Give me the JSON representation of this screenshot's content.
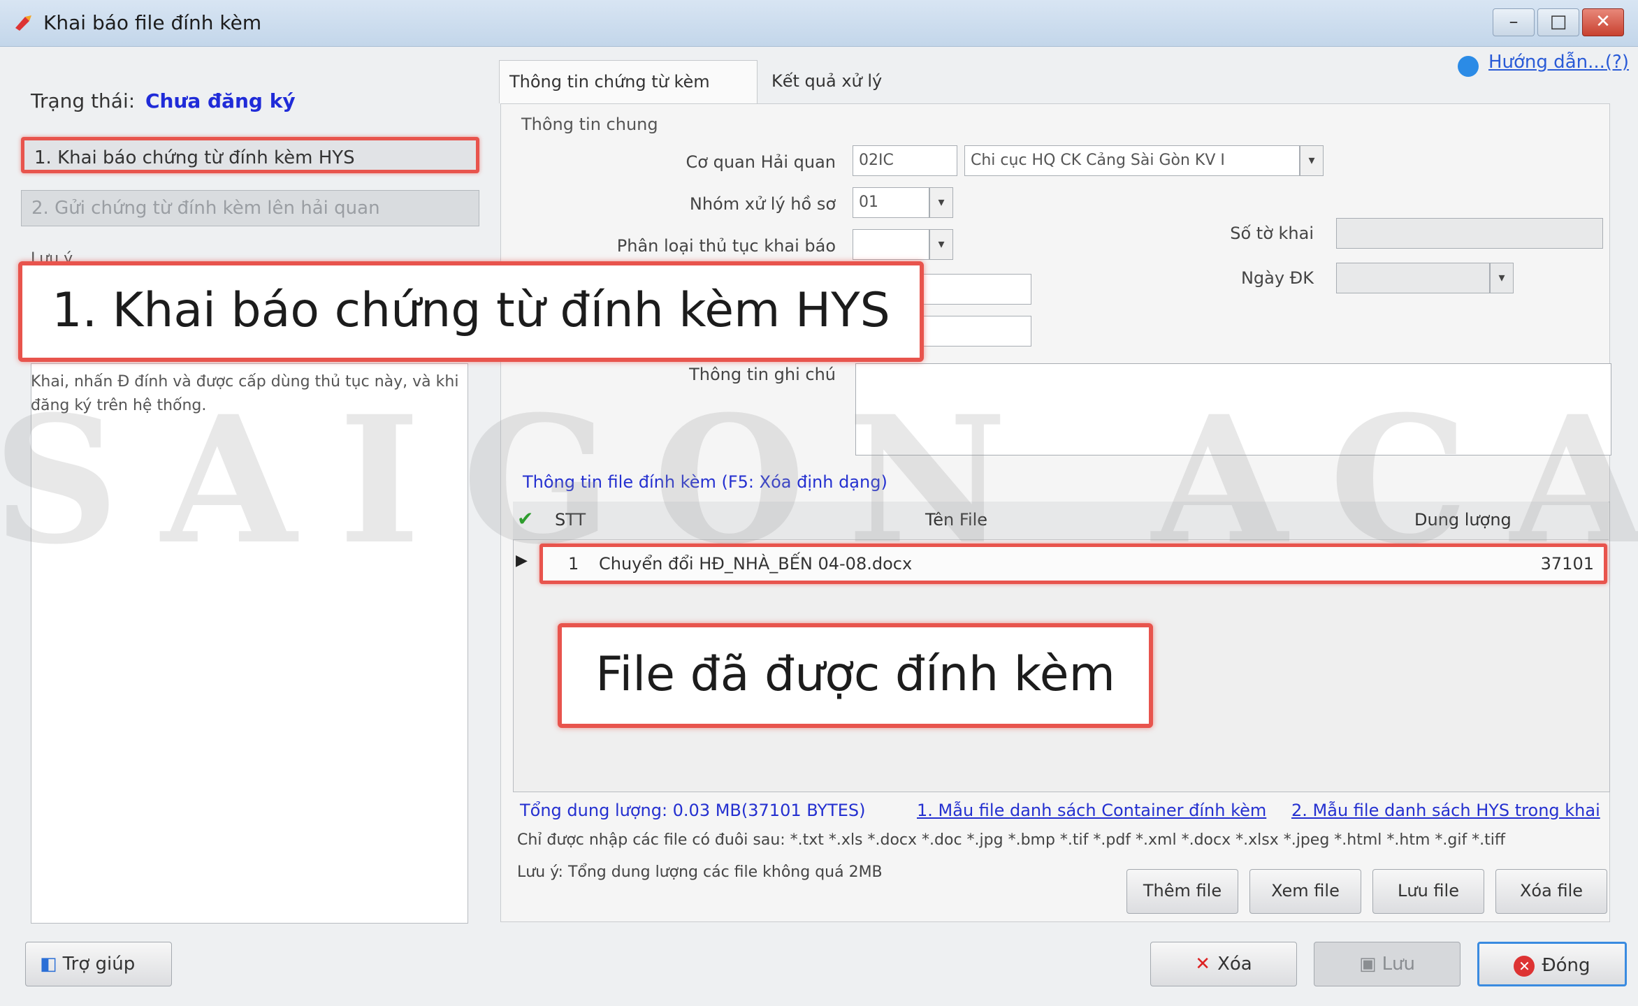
{
  "window": {
    "title": "Khai báo file đính kèm",
    "minimize": "–",
    "maximize": "□",
    "close": "✕"
  },
  "left": {
    "status_label": "Trạng thái:",
    "status_value": "Chưa đăng ký",
    "step1": "1. Khai báo chứng từ đính kèm HYS",
    "step2": "2. Gửi chứng từ đính kèm lên hải quan",
    "list_header": "Lưu ý...",
    "description": "Khai, nhấn Đ đính và được cấp dùng thủ tục này, và khi đăng ký trên hệ thống."
  },
  "tabs": [
    {
      "label": "Thông tin chứng từ kèm theo"
    },
    {
      "label": "Kết quả xử lý"
    }
  ],
  "help_link": "Hướng dẫn...(?)",
  "form": {
    "group_label": "Thông tin chung",
    "customs_label": "Cơ quan Hải quan",
    "customs_code": "02IC",
    "customs_name": "Chi cục HQ CK Cảng Sài Gòn KV I",
    "category_label": "Nhóm xử lý hồ sơ",
    "category_value": "01",
    "procedure_label": "Phân loại thủ tục khai báo",
    "procedure_value": "",
    "doc_no_label": "Số tờ khai",
    "doc_date_label": "Ngày ĐK",
    "note_label": "Thông tin ghi chú"
  },
  "attachments": {
    "title": "Thông tin file đính kèm (F5: Xóa định dạng)",
    "headers": {
      "stt": "STT",
      "name": "Tên File",
      "size": "Dung lượng"
    },
    "rows": [
      {
        "stt": "1",
        "name": "Chuyển đổi HĐ_NHÀ_BẾN 04-08.docx",
        "size": "37101"
      }
    ],
    "totals": "Tổng dung lượng: 0.03 MB(37101 BYTES)",
    "link1": "1. Mẫu file danh sách Container đính kèm",
    "link2": "2. Mẫu file danh sách HYS trong khai",
    "hint1": "Chỉ được nhập các file có đuôi sau:  *.txt *.xls *.docx *.doc *.jpg *.bmp *.tif *.pdf *.xml *.docx *.xlsx *.jpeg *.html *.htm *.gif *.tiff",
    "hint2": "Lưu ý: Tổng dung lượng các file không quá 2MB"
  },
  "buttons": {
    "add": "Thêm file",
    "view": "Xem file",
    "save_file": "Lưu file",
    "delete_file": "Xóa file",
    "help": "Trợ giúp",
    "delete": "Xóa",
    "save": "Lưu",
    "close": "Đóng"
  },
  "callouts": {
    "step": "1. Khai báo chứng từ đính kèm HYS",
    "file": "File đã được đính kèm"
  },
  "watermark": "SAIGON ACADEMY"
}
